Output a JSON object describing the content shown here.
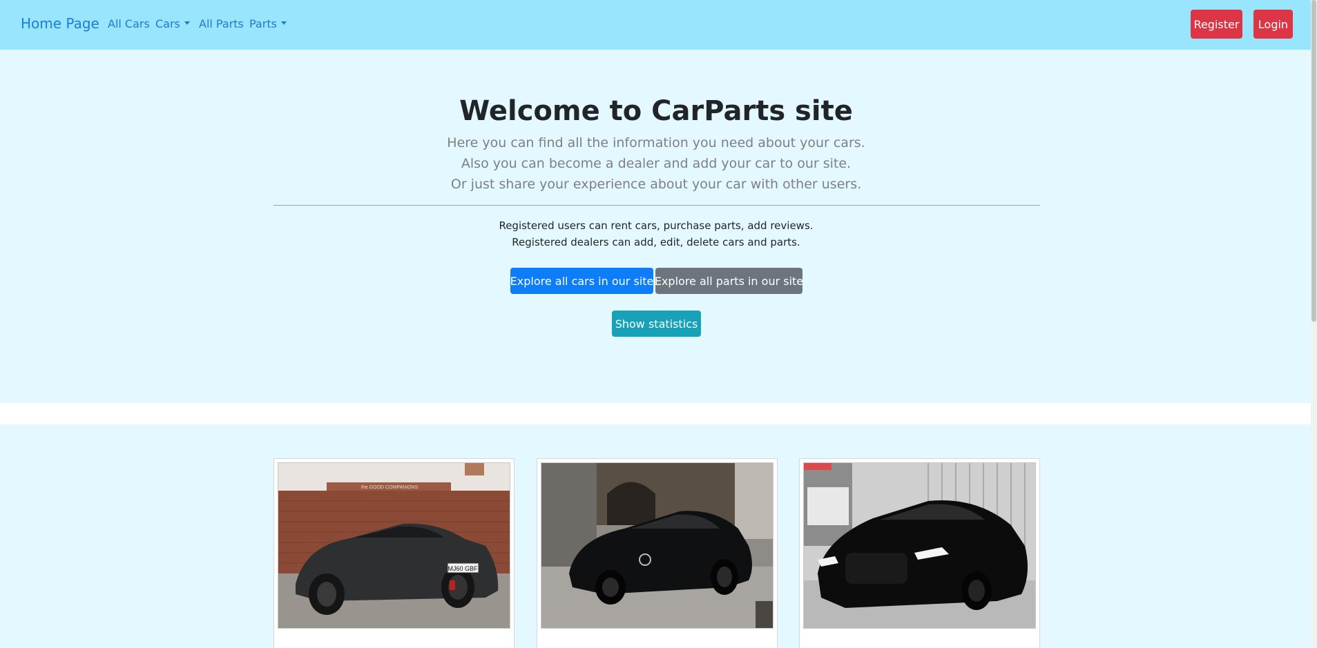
{
  "navbar": {
    "brand": "Home Page",
    "links": [
      "All Cars",
      "Cars",
      "All Parts",
      "Parts"
    ],
    "register": "Register",
    "login": "Login"
  },
  "hero": {
    "title": "Welcome to CarParts site",
    "lead": [
      "Here you can find all the information you need about your cars.",
      "Also you can become a dealer and add your car to our site.",
      "Or just share your experience about your car with other users."
    ],
    "info": [
      "Registered users can rent cars, purchase parts, add reviews.",
      "Registered dealers can add, edit, delete cars and parts."
    ],
    "explore_cars": "Explore all cars in our site",
    "explore_parts": "Explore all parts in our site",
    "show_statistics": "Show statistics"
  },
  "cars": [
    {
      "plate": "MJ60 GBF",
      "sign": "the GOOD COMPANIONS"
    },
    {
      "plate": ""
    },
    {
      "plate": ""
    }
  ],
  "colors": {
    "navbar_bg": "#98e5fd",
    "hero_bg": "#e3f8ff",
    "danger": "#dc3545",
    "primary": "#0d7ef7",
    "secondary": "#6c757d",
    "info": "#17a2b8"
  }
}
